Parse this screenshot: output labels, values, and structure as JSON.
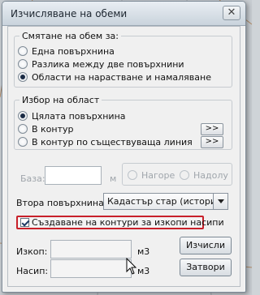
{
  "window": {
    "title": "Изчисляване на обеми",
    "close_glyph": "✕"
  },
  "volume_calc": {
    "legend": "Смятане на обем за:",
    "options": [
      {
        "label": "Една повърхнина",
        "checked": false
      },
      {
        "label": "Разлика между две повърхнини",
        "checked": false
      },
      {
        "label": "Области на нарастване и намаляване",
        "checked": true
      }
    ]
  },
  "area_select": {
    "legend": "Избор на област",
    "options": [
      {
        "label": "Цялата повърхнина",
        "checked": true
      },
      {
        "label": "В контур",
        "checked": false,
        "button": ">>"
      },
      {
        "label": "В контур по съществуваща линия",
        "checked": false,
        "button": ">>"
      }
    ]
  },
  "base": {
    "label": "База:",
    "value": "",
    "unit": "м",
    "up_label": "Нагоре",
    "down_label": "Надолу"
  },
  "second_surface": {
    "label": "Втора повърхнина:",
    "selected": "Кадастър стар (история)"
  },
  "create_contours": {
    "label": "Създаване на контури за изкопи насипи",
    "checked": true
  },
  "results": {
    "excavation_label": "Изкоп:",
    "excavation_value": "",
    "fill_label": "Насип:",
    "fill_value": "",
    "unit": "м3"
  },
  "buttons": {
    "calculate": "Изчисли",
    "close": "Затвори"
  },
  "colors": {
    "highlight_border": "#c8202a"
  }
}
